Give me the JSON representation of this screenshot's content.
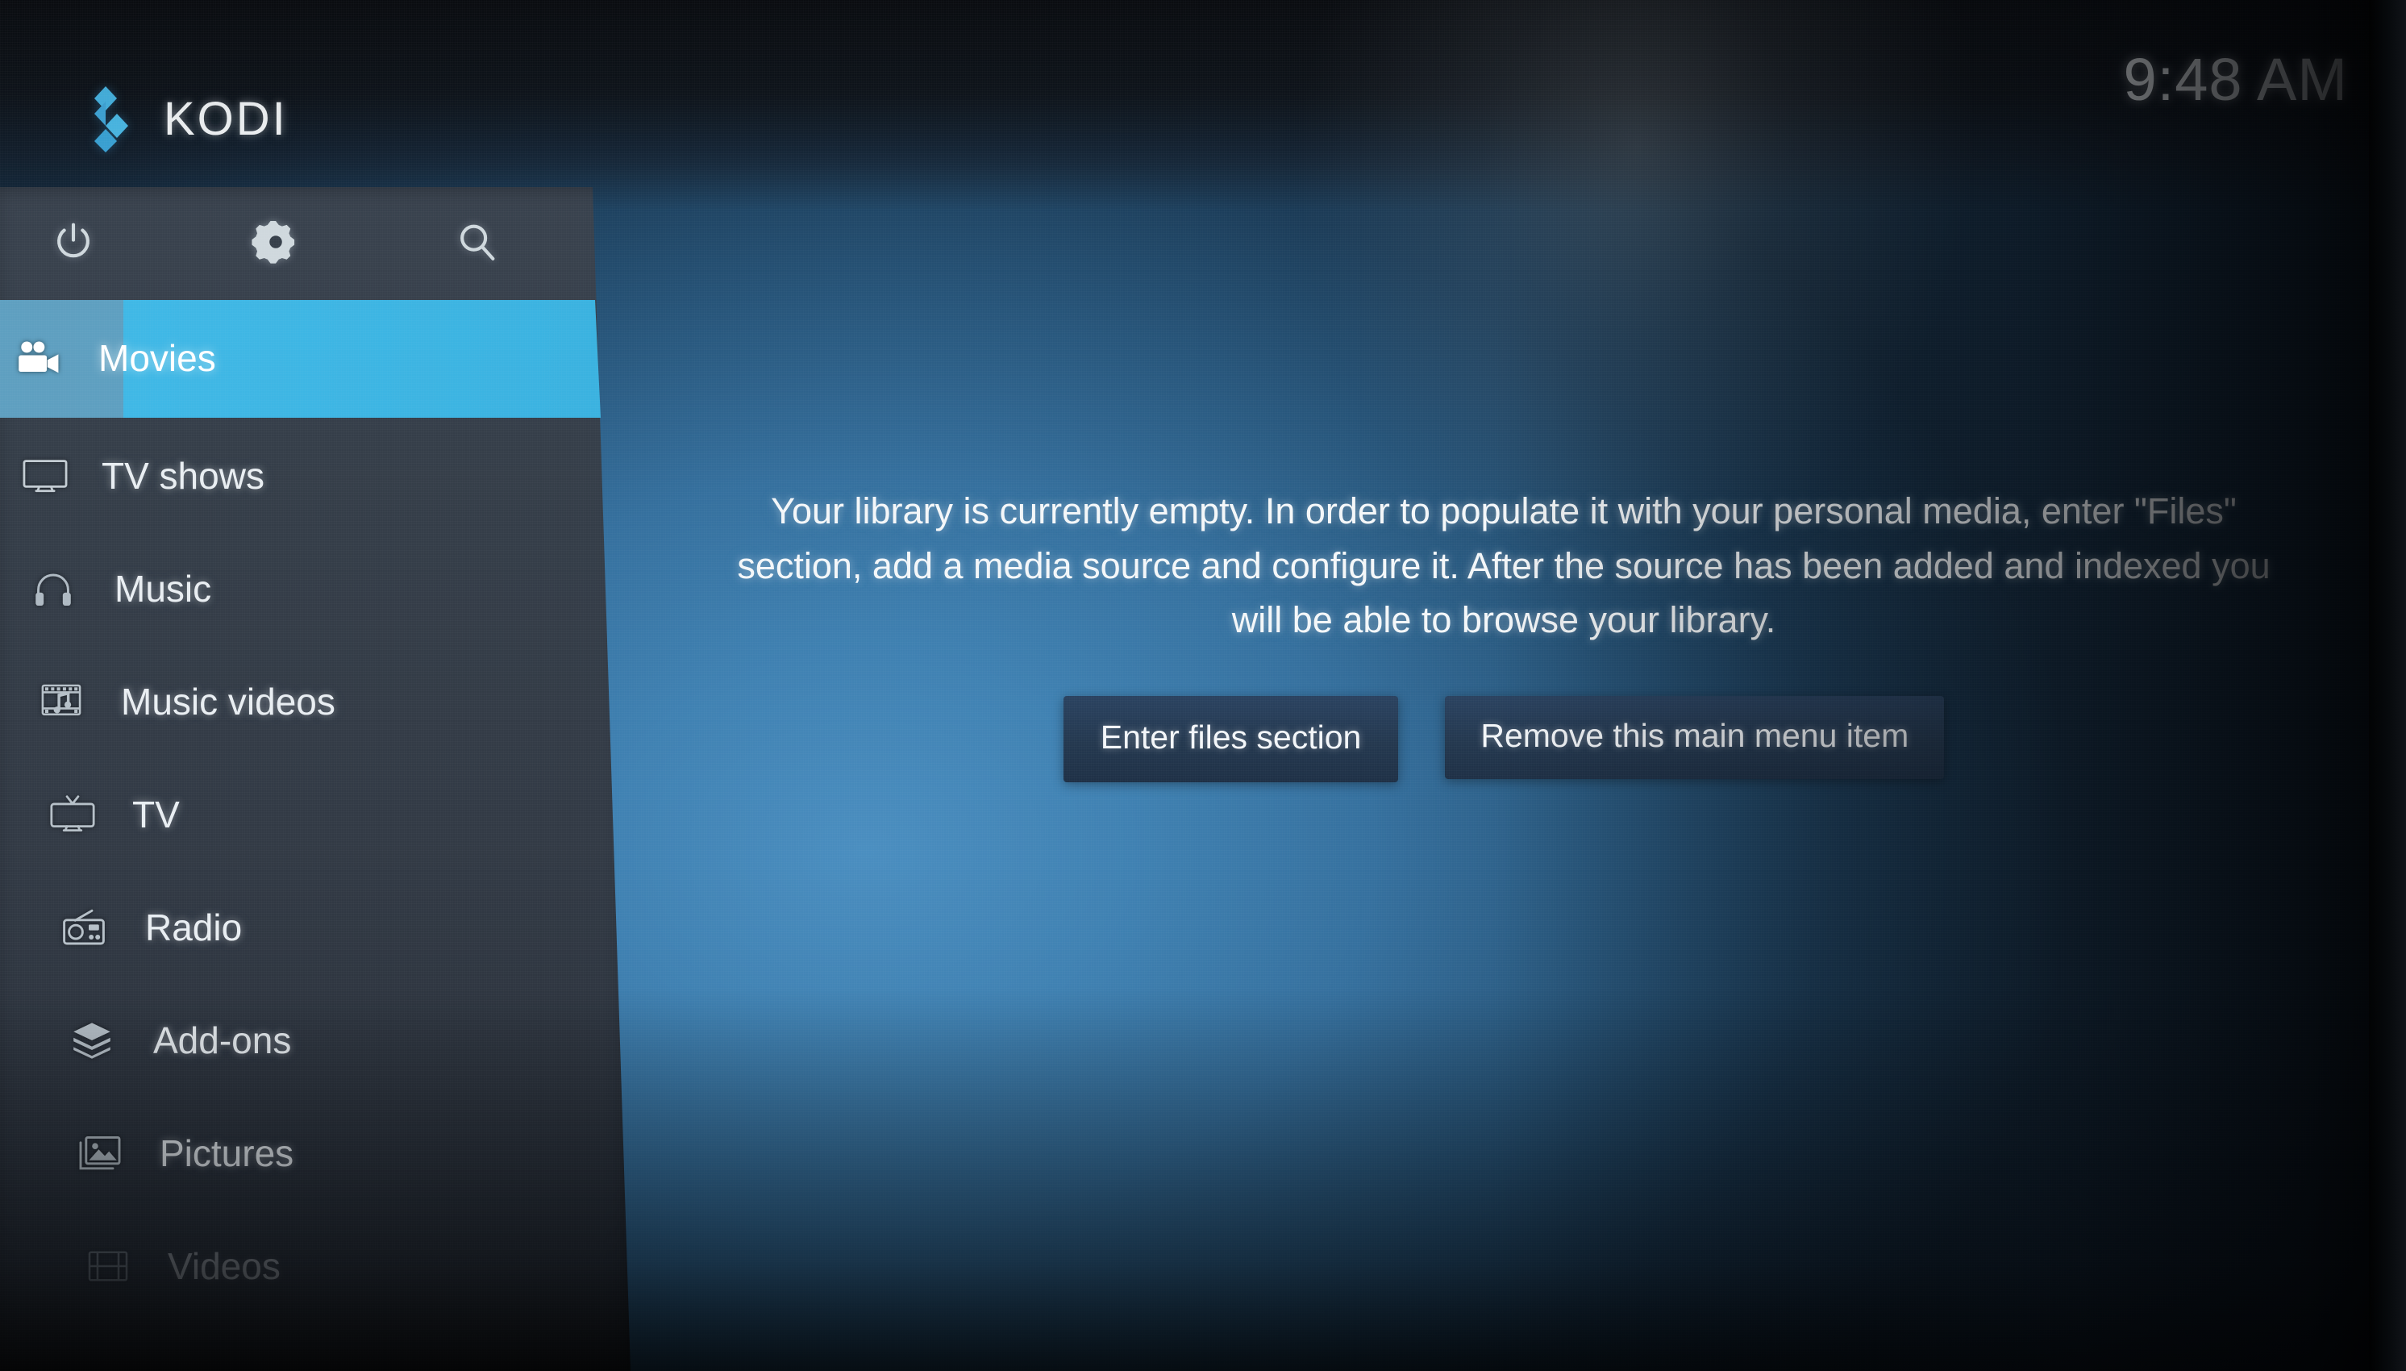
{
  "app": {
    "name": "KODI",
    "logo_icon": "kodi-logo-icon",
    "accent_color": "#3ab2e0",
    "sidebar_color": "#333c47",
    "background_color": "#3a76a3",
    "button_color": "#23384f"
  },
  "header": {
    "clock": "9:48 AM"
  },
  "quick_actions": [
    {
      "name": "power",
      "icon": "power-icon",
      "label": "Power"
    },
    {
      "name": "settings",
      "icon": "gear-icon",
      "label": "Settings"
    },
    {
      "name": "search",
      "icon": "search-icon",
      "label": "Search"
    }
  ],
  "sidebar": {
    "items": [
      {
        "label": "Movies",
        "icon": "movie-camera-icon",
        "selected": true,
        "faded": false
      },
      {
        "label": "TV shows",
        "icon": "monitor-icon",
        "selected": false,
        "faded": false
      },
      {
        "label": "Music",
        "icon": "headphones-icon",
        "selected": false,
        "faded": false
      },
      {
        "label": "Music videos",
        "icon": "film-note-icon",
        "selected": false,
        "faded": false
      },
      {
        "label": "TV",
        "icon": "antenna-tv-icon",
        "selected": false,
        "faded": false
      },
      {
        "label": "Radio",
        "icon": "radio-icon",
        "selected": false,
        "faded": false
      },
      {
        "label": "Add-ons",
        "icon": "addons-box-icon",
        "selected": false,
        "faded": false
      },
      {
        "label": "Pictures",
        "icon": "picture-icon",
        "selected": false,
        "faded": false
      },
      {
        "label": "Videos",
        "icon": "video-film-icon",
        "selected": false,
        "faded": true
      }
    ]
  },
  "main": {
    "empty_message": "Your library is currently empty. In order to populate it with your personal media, enter \"Files\" section, add a media source and configure it. After the source has been added and indexed you will be able to browse your library.",
    "buttons": [
      {
        "label": "Enter files section"
      },
      {
        "label": "Remove this main menu item"
      }
    ]
  }
}
